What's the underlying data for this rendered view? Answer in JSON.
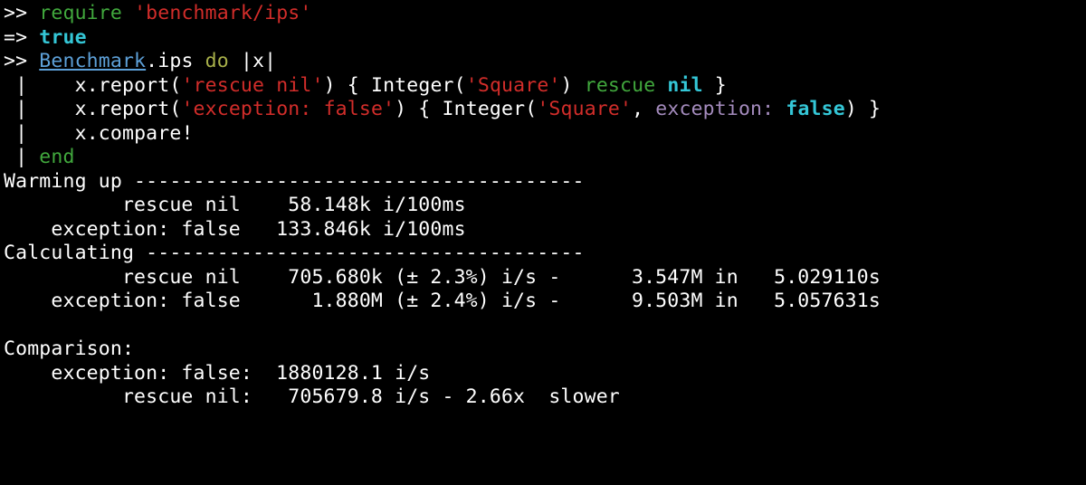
{
  "t": {
    "prompt": ">> ",
    "result_arrow": "=> ",
    "gutter": " | ",
    "require_kw": "require",
    "require_arg": "'benchmark/ips'",
    "true_val": "true",
    "bench_const": "Benchmark",
    "ips_call": ".ips ",
    "do_kw": "do",
    "block_arg": " |x|",
    "indent": "   ",
    "xreport": "x.report(",
    "rparen": ") ",
    "str_rescue_nil": "'rescue nil'",
    "str_exception_false": "'exception: false'",
    "body_open": "{ Integer(",
    "str_square": "'Square'",
    "body_close_plain": ") ",
    "rescue_kw": "rescue",
    "space": " ",
    "nil_kw": "nil",
    "trail_brace": " }",
    "comma": ", ",
    "exception_key": "exception:",
    "false_kw": "false",
    "close_paren_brace": ") }",
    "xcompare": "x.compare!",
    "end_kw": "end",
    "warmup_line": "Warming up --------------------------------------",
    "warm1": "          rescue nil    58.148k i/100ms",
    "warm2": "    exception: false   133.846k i/100ms",
    "calc_line": "Calculating -------------------------------------",
    "calc1": "          rescue nil    705.680k (± 2.3%) i/s -      3.547M in   5.029110s",
    "calc2": "    exception: false      1.880M (± 2.4%) i/s -      9.503M in   5.057631s",
    "blank": "",
    "cmp_head": "Comparison:",
    "cmp1": "    exception: false:  1880128.1 i/s",
    "cmp2": "          rescue nil:   705679.8 i/s - 2.66x  slower"
  },
  "chart_data": {
    "type": "table",
    "title": "Benchmark.ips comparison",
    "warmup": [
      {
        "name": "rescue nil",
        "iterations_per_100ms": "58.148k"
      },
      {
        "name": "exception: false",
        "iterations_per_100ms": "133.846k"
      }
    ],
    "calculating": [
      {
        "name": "rescue nil",
        "ips": "705.680k",
        "stddev": "± 2.3%",
        "total": "3.547M",
        "seconds": "5.029110s"
      },
      {
        "name": "exception: false",
        "ips": "1.880M",
        "stddev": "± 2.4%",
        "total": "9.503M",
        "seconds": "5.057631s"
      }
    ],
    "comparison": [
      {
        "name": "exception: false",
        "ips": 1880128.1,
        "note": ""
      },
      {
        "name": "rescue nil",
        "ips": 705679.8,
        "note": "2.66x  slower"
      }
    ]
  }
}
